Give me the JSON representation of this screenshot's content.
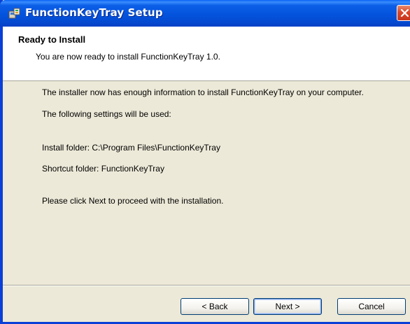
{
  "window": {
    "title": "FunctionKeyTray Setup",
    "app_icon": "installer-icon",
    "close_icon": "close-icon",
    "title_bar_color": "#0a53e0",
    "close_button_color": "#d9482a"
  },
  "header": {
    "title": "Ready to Install",
    "subtitle": "You are now ready to install FunctionKeyTray 1.0."
  },
  "body": {
    "line1": "The installer now has enough information to install FunctionKeyTray on your computer.",
    "line2": "The following settings will be used:",
    "install_folder": "Install folder:  C:\\Program Files\\FunctionKeyTray",
    "shortcut_folder": "Shortcut folder:  FunctionKeyTray",
    "proceed": "Please click Next to proceed with the installation."
  },
  "buttons": {
    "back": "< Back",
    "next": "Next >",
    "cancel": "Cancel"
  }
}
